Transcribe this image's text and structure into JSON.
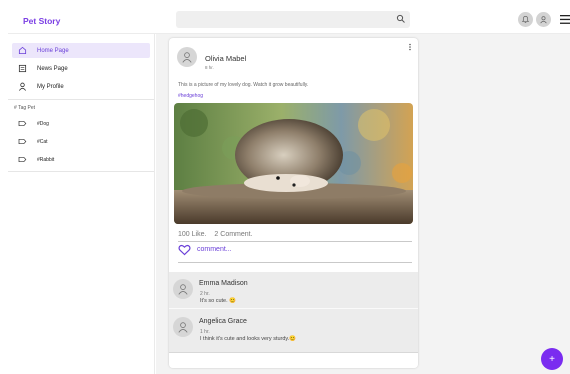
{
  "app": {
    "brand": "Pet Story",
    "accent": "#7b3fe4"
  },
  "topbar": {
    "search_icon": "search-icon",
    "bell_icon": "bell-icon",
    "profile_icon": "user-icon",
    "menu_icon": "menu-icon"
  },
  "sidebar": {
    "nav": [
      {
        "label": "Home Page",
        "icon": "home-icon",
        "active": true
      },
      {
        "label": "News Page",
        "icon": "newspaper-icon",
        "active": false
      },
      {
        "label": "My Profile",
        "icon": "person-icon",
        "active": false
      }
    ],
    "tags_title": "# Tag Pet",
    "tags": [
      {
        "label": "#Dog",
        "icon": "tag-icon"
      },
      {
        "label": "#Cat",
        "icon": "tag-icon"
      },
      {
        "label": "#Rabbit",
        "icon": "tag-icon"
      }
    ]
  },
  "post": {
    "author": "Olivia Mabel",
    "time": "8 hr.",
    "text": "This is a picture of my lovely dog. Watch it grow beautifully.",
    "hashtag": "#hedgehog",
    "likes": "100 Like.",
    "comments_count": "2 Comment.",
    "comment_prompt": "comment..."
  },
  "comments": [
    {
      "name": "Emma Madison",
      "time": "2 hr.",
      "text": "It's so cute. 😊"
    },
    {
      "name": "Angelica Grace",
      "time": "1 hr.",
      "text": "I think it's cute and looks very sturdy.😊"
    }
  ],
  "fab": {
    "label": "+"
  }
}
